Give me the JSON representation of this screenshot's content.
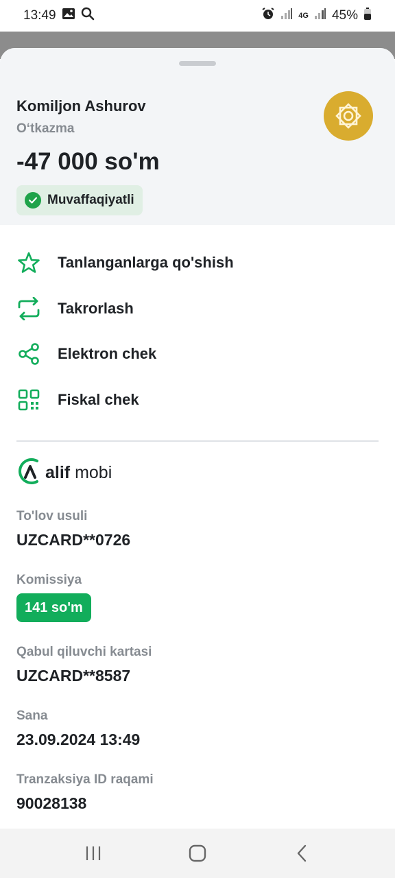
{
  "status_bar": {
    "time": "13:49",
    "network": "4G",
    "battery": "45%",
    "icons": [
      "gallery-icon",
      "search-icon",
      "alarm-icon",
      "signal-icon",
      "battery-icon"
    ]
  },
  "header": {
    "recipient_name": "Komiljon Ashurov",
    "transaction_type": "O‘tkazma",
    "amount": "-47 000 so'm",
    "status": "Muvaffaqiyatli",
    "status_color": "#1fa34a",
    "logo_color": "#d9ac2f"
  },
  "actions": [
    {
      "label": "Tanlanganlarga qo'shish",
      "icon": "star-icon"
    },
    {
      "label": "Takrorlash",
      "icon": "repeat-icon"
    },
    {
      "label": "Elektron chek",
      "icon": "share-icon"
    },
    {
      "label": "Fiskal chek",
      "icon": "qr-code-icon"
    }
  ],
  "accent_color": "#12ad5b",
  "brand": {
    "name_bold": "alif",
    "name_light": "mobi"
  },
  "details": {
    "payment_method_label": "To'lov usuli",
    "payment_method_value": "UZCARD**0726",
    "fee_label": "Komissiya",
    "fee_value": "141 so'm",
    "recipient_card_label": "Qabul qiluvchi kartasi",
    "recipient_card_value": "UZCARD**8587",
    "date_label": "Sana",
    "date_value": "23.09.2024 13:49",
    "transaction_id_label": "Tranzaksiya ID raqami",
    "transaction_id_value": "90028138"
  }
}
